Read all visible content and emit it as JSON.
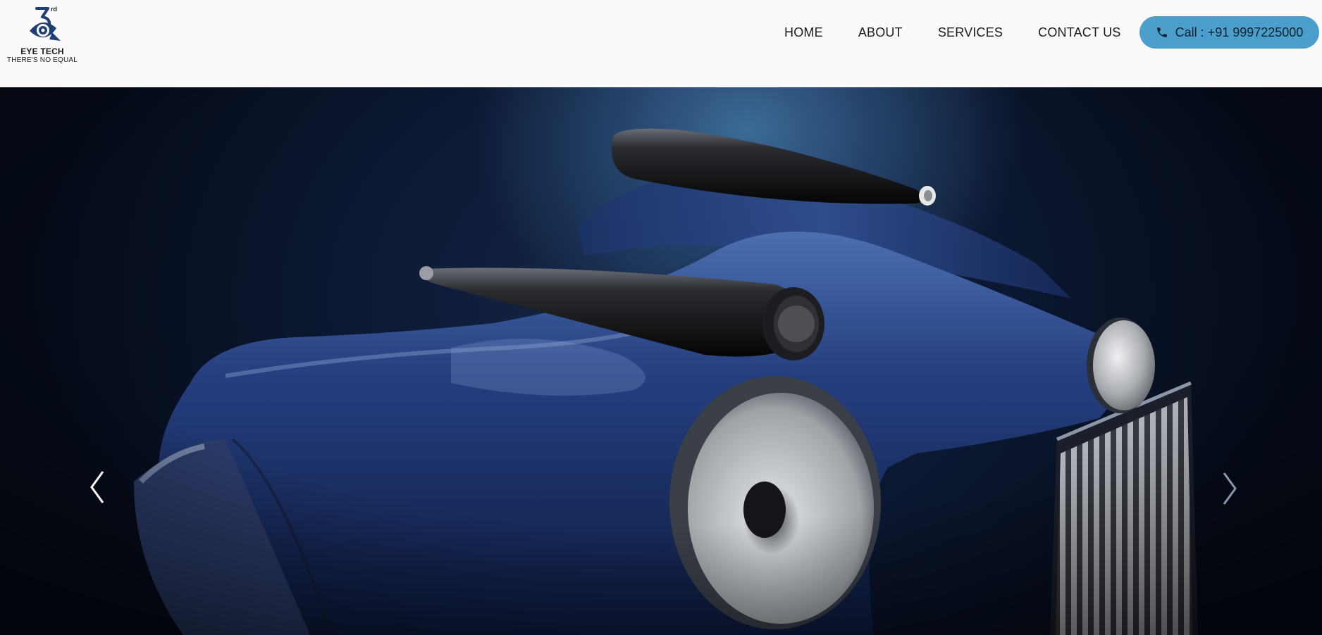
{
  "brand": {
    "logo_mark_text": "3rd",
    "name": "EYE TECH",
    "tagline": "THERE'S NO EQUAL",
    "logo_color": "#1e3f74"
  },
  "nav": {
    "items": [
      {
        "label": "HOME"
      },
      {
        "label": "ABOUT"
      },
      {
        "label": "SERVICES"
      },
      {
        "label": "CONTACT US"
      }
    ]
  },
  "call_button": {
    "label": "Call : +91 9997225000",
    "icon": "phone-icon",
    "color": "#4b9fcd"
  },
  "hero": {
    "icons": {
      "prev": "chevron-left-icon",
      "next": "chevron-right-icon"
    },
    "colors": {
      "background": "#0b1730",
      "speaker_body": "#1f3772",
      "accent": "#3c6a97"
    }
  }
}
